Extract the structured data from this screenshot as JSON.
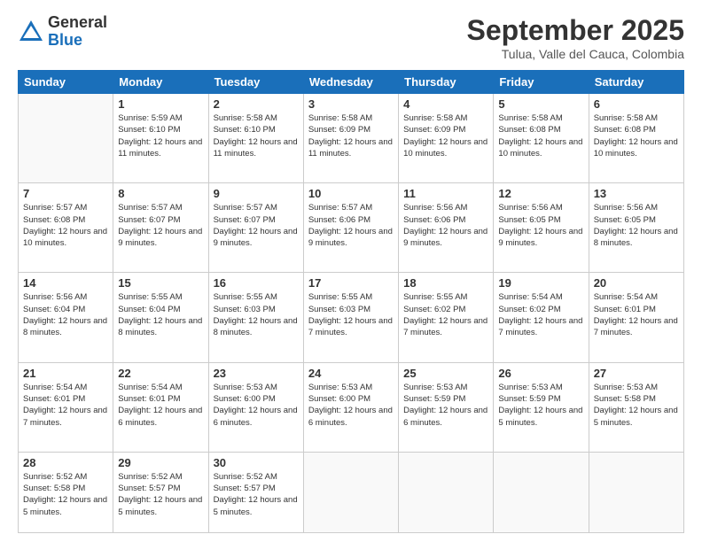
{
  "header": {
    "logo_general": "General",
    "logo_blue": "Blue",
    "month_title": "September 2025",
    "location": "Tulua, Valle del Cauca, Colombia"
  },
  "days_of_week": [
    "Sunday",
    "Monday",
    "Tuesday",
    "Wednesday",
    "Thursday",
    "Friday",
    "Saturday"
  ],
  "weeks": [
    [
      {
        "day": "",
        "info": ""
      },
      {
        "day": "1",
        "info": "Sunrise: 5:59 AM\nSunset: 6:10 PM\nDaylight: 12 hours\nand 11 minutes."
      },
      {
        "day": "2",
        "info": "Sunrise: 5:58 AM\nSunset: 6:10 PM\nDaylight: 12 hours\nand 11 minutes."
      },
      {
        "day": "3",
        "info": "Sunrise: 5:58 AM\nSunset: 6:09 PM\nDaylight: 12 hours\nand 11 minutes."
      },
      {
        "day": "4",
        "info": "Sunrise: 5:58 AM\nSunset: 6:09 PM\nDaylight: 12 hours\nand 10 minutes."
      },
      {
        "day": "5",
        "info": "Sunrise: 5:58 AM\nSunset: 6:08 PM\nDaylight: 12 hours\nand 10 minutes."
      },
      {
        "day": "6",
        "info": "Sunrise: 5:58 AM\nSunset: 6:08 PM\nDaylight: 12 hours\nand 10 minutes."
      }
    ],
    [
      {
        "day": "7",
        "info": "Sunrise: 5:57 AM\nSunset: 6:08 PM\nDaylight: 12 hours\nand 10 minutes."
      },
      {
        "day": "8",
        "info": "Sunrise: 5:57 AM\nSunset: 6:07 PM\nDaylight: 12 hours\nand 9 minutes."
      },
      {
        "day": "9",
        "info": "Sunrise: 5:57 AM\nSunset: 6:07 PM\nDaylight: 12 hours\nand 9 minutes."
      },
      {
        "day": "10",
        "info": "Sunrise: 5:57 AM\nSunset: 6:06 PM\nDaylight: 12 hours\nand 9 minutes."
      },
      {
        "day": "11",
        "info": "Sunrise: 5:56 AM\nSunset: 6:06 PM\nDaylight: 12 hours\nand 9 minutes."
      },
      {
        "day": "12",
        "info": "Sunrise: 5:56 AM\nSunset: 6:05 PM\nDaylight: 12 hours\nand 9 minutes."
      },
      {
        "day": "13",
        "info": "Sunrise: 5:56 AM\nSunset: 6:05 PM\nDaylight: 12 hours\nand 8 minutes."
      }
    ],
    [
      {
        "day": "14",
        "info": "Sunrise: 5:56 AM\nSunset: 6:04 PM\nDaylight: 12 hours\nand 8 minutes."
      },
      {
        "day": "15",
        "info": "Sunrise: 5:55 AM\nSunset: 6:04 PM\nDaylight: 12 hours\nand 8 minutes."
      },
      {
        "day": "16",
        "info": "Sunrise: 5:55 AM\nSunset: 6:03 PM\nDaylight: 12 hours\nand 8 minutes."
      },
      {
        "day": "17",
        "info": "Sunrise: 5:55 AM\nSunset: 6:03 PM\nDaylight: 12 hours\nand 7 minutes."
      },
      {
        "day": "18",
        "info": "Sunrise: 5:55 AM\nSunset: 6:02 PM\nDaylight: 12 hours\nand 7 minutes."
      },
      {
        "day": "19",
        "info": "Sunrise: 5:54 AM\nSunset: 6:02 PM\nDaylight: 12 hours\nand 7 minutes."
      },
      {
        "day": "20",
        "info": "Sunrise: 5:54 AM\nSunset: 6:01 PM\nDaylight: 12 hours\nand 7 minutes."
      }
    ],
    [
      {
        "day": "21",
        "info": "Sunrise: 5:54 AM\nSunset: 6:01 PM\nDaylight: 12 hours\nand 7 minutes."
      },
      {
        "day": "22",
        "info": "Sunrise: 5:54 AM\nSunset: 6:01 PM\nDaylight: 12 hours\nand 6 minutes."
      },
      {
        "day": "23",
        "info": "Sunrise: 5:53 AM\nSunset: 6:00 PM\nDaylight: 12 hours\nand 6 minutes."
      },
      {
        "day": "24",
        "info": "Sunrise: 5:53 AM\nSunset: 6:00 PM\nDaylight: 12 hours\nand 6 minutes."
      },
      {
        "day": "25",
        "info": "Sunrise: 5:53 AM\nSunset: 5:59 PM\nDaylight: 12 hours\nand 6 minutes."
      },
      {
        "day": "26",
        "info": "Sunrise: 5:53 AM\nSunset: 5:59 PM\nDaylight: 12 hours\nand 5 minutes."
      },
      {
        "day": "27",
        "info": "Sunrise: 5:53 AM\nSunset: 5:58 PM\nDaylight: 12 hours\nand 5 minutes."
      }
    ],
    [
      {
        "day": "28",
        "info": "Sunrise: 5:52 AM\nSunset: 5:58 PM\nDaylight: 12 hours\nand 5 minutes."
      },
      {
        "day": "29",
        "info": "Sunrise: 5:52 AM\nSunset: 5:57 PM\nDaylight: 12 hours\nand 5 minutes."
      },
      {
        "day": "30",
        "info": "Sunrise: 5:52 AM\nSunset: 5:57 PM\nDaylight: 12 hours\nand 5 minutes."
      },
      {
        "day": "",
        "info": ""
      },
      {
        "day": "",
        "info": ""
      },
      {
        "day": "",
        "info": ""
      },
      {
        "day": "",
        "info": ""
      }
    ]
  ]
}
